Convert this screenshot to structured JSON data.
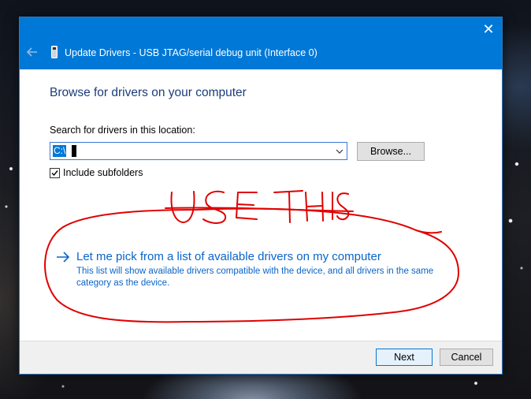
{
  "window": {
    "title": "Update Drivers - USB JTAG/serial debug unit (Interface 0)",
    "close_glyph": "✕",
    "accent": "#0078d7",
    "icons": [
      "back-arrow-icon",
      "usb-device-icon",
      "close-icon"
    ]
  },
  "page": {
    "heading": "Browse for drivers on your computer",
    "search_label": "Search for drivers in this location:",
    "path_value": "C:\\",
    "browse_label": "Browse...",
    "include_subfolders_label": "Include subfolders",
    "include_subfolders_checked": true
  },
  "link_option": {
    "title": "Let me pick from a list of available drivers on my computer",
    "description": "This list will show available drivers compatible with the device, and all drivers in the same category as the device.",
    "color": "#0a64c8"
  },
  "footer": {
    "next_label": "Next",
    "cancel_label": "Cancel"
  },
  "annotation": {
    "text": "USE THIS",
    "color": "#e00000"
  }
}
